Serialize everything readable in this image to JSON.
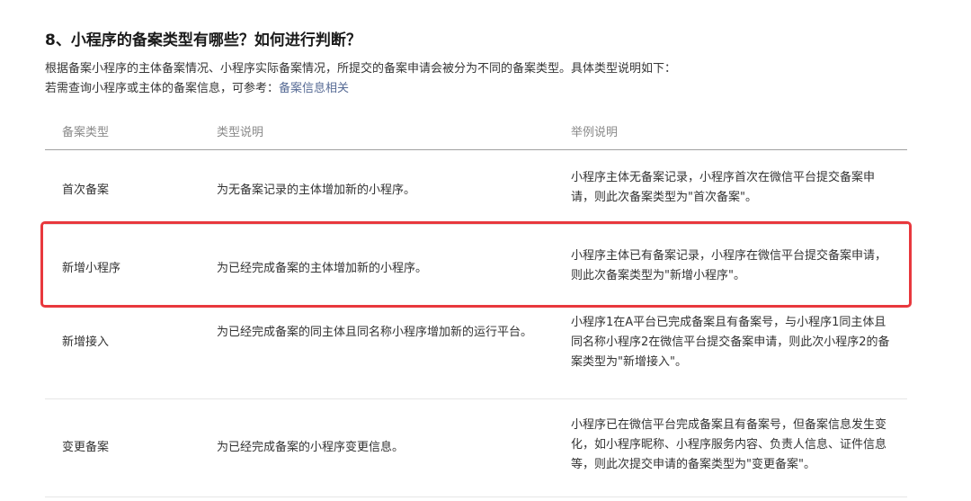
{
  "title": "8、小程序的备案类型有哪些？如何进行判断？",
  "intro": {
    "line1": "根据备案小程序的主体备案情况、小程序实际备案情况，所提交的备案申请会被分为不同的备案类型。具体类型说明如下：",
    "line2_prefix": "若需查询小程序或主体的备案信息，可参考：",
    "line2_link": "备案信息相关"
  },
  "table": {
    "headers": [
      "备案类型",
      "类型说明",
      "举例说明"
    ],
    "rows": [
      {
        "type": "首次备案",
        "desc": "为无备案记录的主体增加新的小程序。",
        "example": "小程序主体无备案记录，小程序首次在微信平台提交备案申请，则此次备案类型为\"首次备案\"。"
      },
      {
        "type": "新增小程序",
        "desc": "为已经完成备案的主体增加新的小程序。",
        "example": "小程序主体已有备案记录，小程序在微信平台提交备案申请，则此次备案类型为\"新增小程序\"。"
      },
      {
        "type": "新增接入",
        "desc": "为已经完成备案的同主体且同名称小程序增加新的运行平台。",
        "example": "小程序1在A平台已完成备案且有备案号，与小程序1同主体且同名称小程序2在微信平台提交备案申请，则此次小程序2的备案类型为\"新增接入\"。"
      },
      {
        "type": "变更备案",
        "desc": "为已经完成备案的小程序变更信息。",
        "example": "小程序已在微信平台完成备案且有备案号，但备案信息发生变化，如小程序昵称、小程序服务内容、负责人信息、证件信息等，则此次提交申请的备案类型为\"变更备案\"。"
      }
    ]
  },
  "colors": {
    "link": "#576b95",
    "highlight_border": "#e8383d"
  }
}
